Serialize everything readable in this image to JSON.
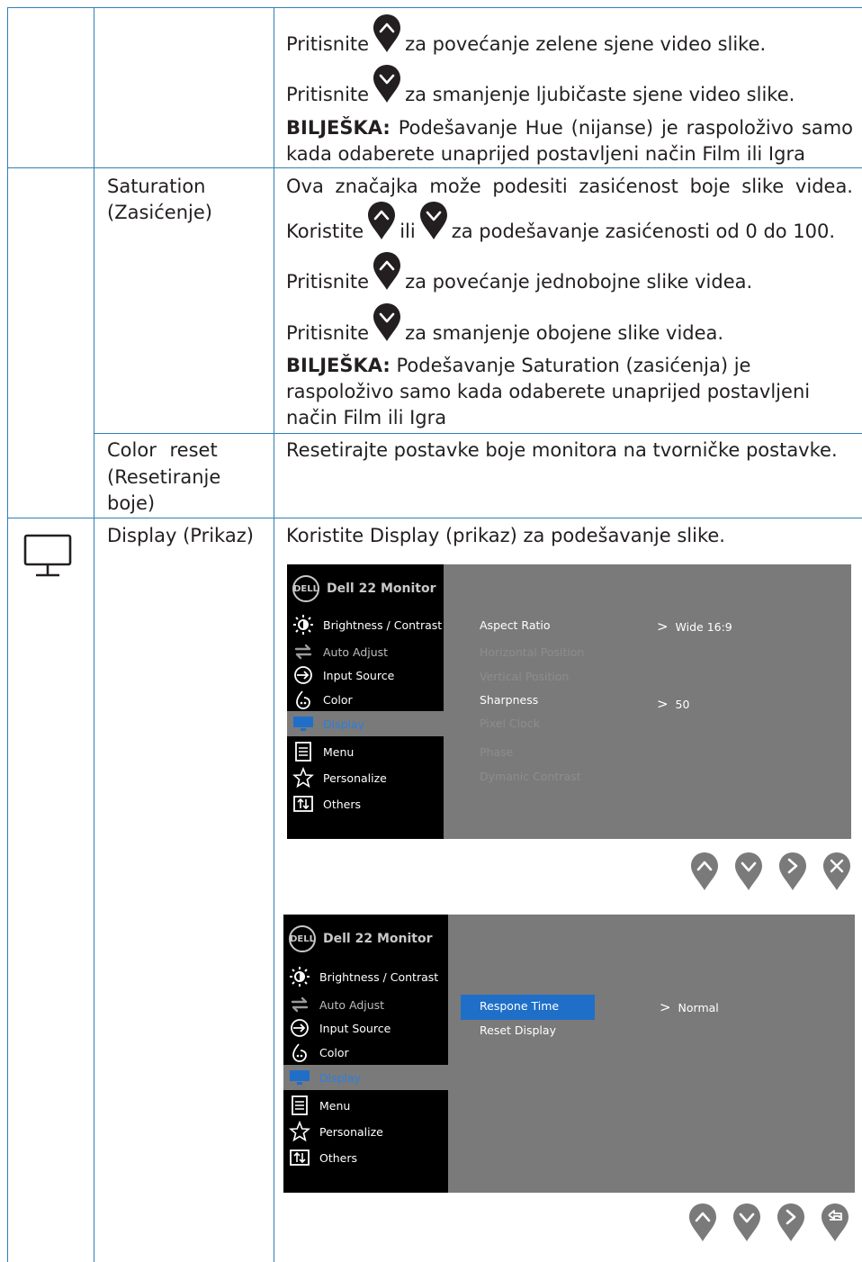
{
  "row_hue": {
    "line1_pre": "Pritisnite",
    "line1_post": "za povećanje zelene sjene video slike.",
    "line2_pre": "Pritisnite",
    "line2_post": "za smanjenje ljubičaste sjene video slike.",
    "note_label": "BILJEŠKA:",
    "note_line1": "Podešavanje Hue (nijanse) je raspoloživo samo",
    "note_line2": "kada odaberete unaprijed postavljeni način Film ili Igra"
  },
  "row_saturation": {
    "name_line1": "Saturation",
    "name_line2": "(Zasićenje)",
    "desc_line1": "Ova značajka može podesiti zasićenost boje slike videa.",
    "desc_line2_pre": "Koristite",
    "desc_line2_mid": "ili",
    "desc_line2_post": "za podešavanje zasićenosti od 0 do 100.",
    "line3_pre": "Pritisnite",
    "line3_post": "za povećanje jednobojne slike videa.",
    "line4_pre": "Pritisnite",
    "line4_post": "za smanjenje obojene slike videa.",
    "note_label": "BILJEŠKA:",
    "note_line1": "Podešavanje Saturation (zasićenja) je",
    "note_line2": "raspoloživo samo kada odaberete unaprijed postavljeni",
    "note_line3": "način Film ili Igra"
  },
  "row_color_reset": {
    "name_line1": "Color reset",
    "name_line2": "(Resetiranje",
    "name_line3": "boje)",
    "desc": "Resetirajte postavke boje monitora na tvorničke postavke."
  },
  "row_display": {
    "icon": "monitor-icon",
    "name": "Display (Prikaz)",
    "desc": "Koristite Display (prikaz) za podešavanje slike."
  },
  "osd_common": {
    "logo": "DELL",
    "model": "Dell 22 Monitor",
    "menu": [
      {
        "label": "Brightness / Contrast",
        "icon": "brightness-icon"
      },
      {
        "label": "Auto Adjust",
        "icon": "auto-adjust-icon"
      },
      {
        "label": "Input Source",
        "icon": "input-source-icon"
      },
      {
        "label": "Color",
        "icon": "color-icon"
      },
      {
        "label": "Display",
        "icon": "display-icon"
      },
      {
        "label": "Menu",
        "icon": "menu-icon"
      },
      {
        "label": "Personalize",
        "icon": "star-icon"
      },
      {
        "label": "Others",
        "icon": "others-icon"
      }
    ]
  },
  "osd1": {
    "options": [
      "Aspect Ratio",
      "Horizontal Position",
      "Vertical Position",
      "Sharpness",
      "Pixel Clock",
      "Phase",
      "Dymanic Contrast"
    ],
    "aspect_value": "Wide 16:9",
    "sharpness_value": "50",
    "buttons": [
      "up-icon",
      "down-icon",
      "right-icon",
      "close-icon"
    ]
  },
  "osd2": {
    "options": [
      "Respone Time",
      "Reset Display"
    ],
    "response_value": "Normal",
    "buttons": [
      "up-icon",
      "down-icon",
      "right-icon",
      "back-icon"
    ]
  },
  "colors": {
    "rule": "#2f7fb5",
    "osd_bg": "#7a7a7a",
    "highlight": "#1f6fc9",
    "selected_text": "#2b7fe0"
  }
}
